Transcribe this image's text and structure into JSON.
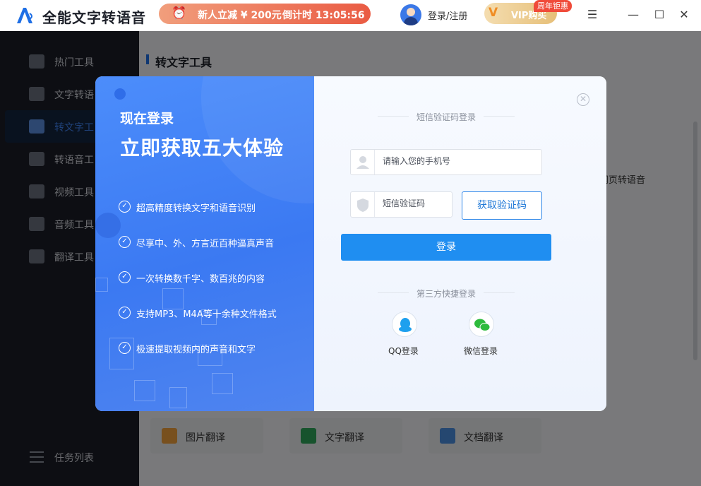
{
  "app": {
    "title": "全能文字转语音",
    "promo_text": "新人立减 ¥ 200元",
    "promo_timer": "倒计时 13:05:56",
    "login_link": "登录/注册",
    "vip_label": "VIP购买",
    "vip_badge": "周年钜惠"
  },
  "window_controls": {
    "menu": "☰",
    "minimize": "—",
    "maximize": "☐",
    "close": "✕"
  },
  "sidebar": {
    "items": [
      {
        "label": "热门工具",
        "icon": "grid-icon"
      },
      {
        "label": "文字转语",
        "icon": "text-to-speech-icon"
      },
      {
        "label": "转文字工",
        "icon": "to-text-icon",
        "active": true
      },
      {
        "label": "转语音工",
        "icon": "to-speech-icon"
      },
      {
        "label": "视频工具",
        "icon": "video-icon"
      },
      {
        "label": "音频工具",
        "icon": "audio-icon"
      },
      {
        "label": "翻译工具",
        "icon": "translate-icon"
      }
    ],
    "bottom": {
      "label": "任务列表",
      "icon": "task-list-icon"
    }
  },
  "main": {
    "section_title": "转文字工具",
    "right_card_label": "网页转语音",
    "bottom_cards": [
      {
        "label": "图片翻译",
        "icon": "image-translate-icon",
        "color": "#f0a13c"
      },
      {
        "label": "文字翻译",
        "icon": "text-translate-icon",
        "color": "#2fa75a"
      },
      {
        "label": "文档翻译",
        "icon": "doc-translate-icon",
        "color": "#4a8fe0"
      }
    ]
  },
  "modal": {
    "left": {
      "subtitle": "现在登录",
      "title": "立即获取五大体验",
      "features": [
        "超高精度转换文字和语音识别",
        "尽享中、外、方言近百种逼真声音",
        "一次转换数千字、数百兆的内容",
        "支持MP3、M4A等十余种文件格式",
        "极速提取视频内的声音和文字"
      ]
    },
    "right": {
      "sms_heading": "短信验证码登录",
      "phone_placeholder": "请输入您的手机号",
      "code_placeholder": "短信验证码",
      "get_code_label": "获取验证码",
      "login_label": "登录",
      "third_party_heading": "第三方快捷登录",
      "qq_label": "QQ登录",
      "wechat_label": "微信登录",
      "close": "✕"
    }
  },
  "colors": {
    "primary": "#1f8ef1",
    "sidebar_bg": "#1a1d26",
    "modal_left": "#3b79f2"
  }
}
